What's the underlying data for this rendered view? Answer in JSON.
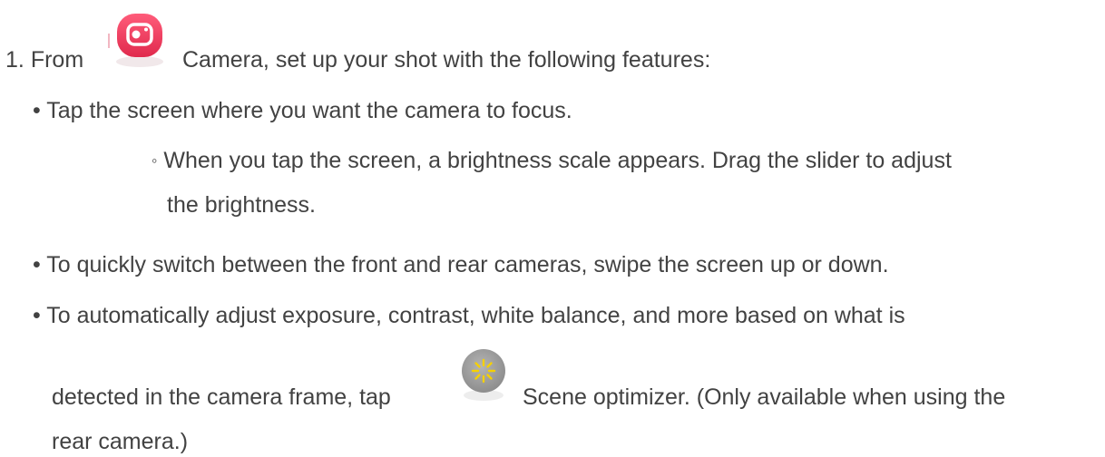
{
  "step": {
    "number": "1.",
    "prefix": "From",
    "app_name": "Camera,",
    "text": "set up your shot with the following features:"
  },
  "bullets": [
    {
      "marker": "•",
      "text": "Tap the screen where you want the camera to focus.",
      "sub": {
        "marker": "◦",
        "line1": "When you tap the screen, a brightness scale appears. Drag the slider to adjust",
        "line2": "the brightness."
      }
    },
    {
      "marker": "•",
      "text": "To quickly switch between the front and rear cameras, swipe the screen up or down."
    },
    {
      "marker": "•",
      "line1": "To automatically adjust exposure, contrast, white balance, and more based on what is",
      "line2_prefix": "detected in the camera frame, tap",
      "line2_suffix": "Scene optimizer. (Only available when using the",
      "line3": "rear camera.)"
    }
  ],
  "icons": {
    "camera_app": "camera-app-icon",
    "scene_optimizer": "scene-optimizer-icon",
    "camera_icon_color": "#e8365a",
    "scene_icon_bg": "#9e9e9e",
    "scene_icon_fg": "#f5d000"
  }
}
